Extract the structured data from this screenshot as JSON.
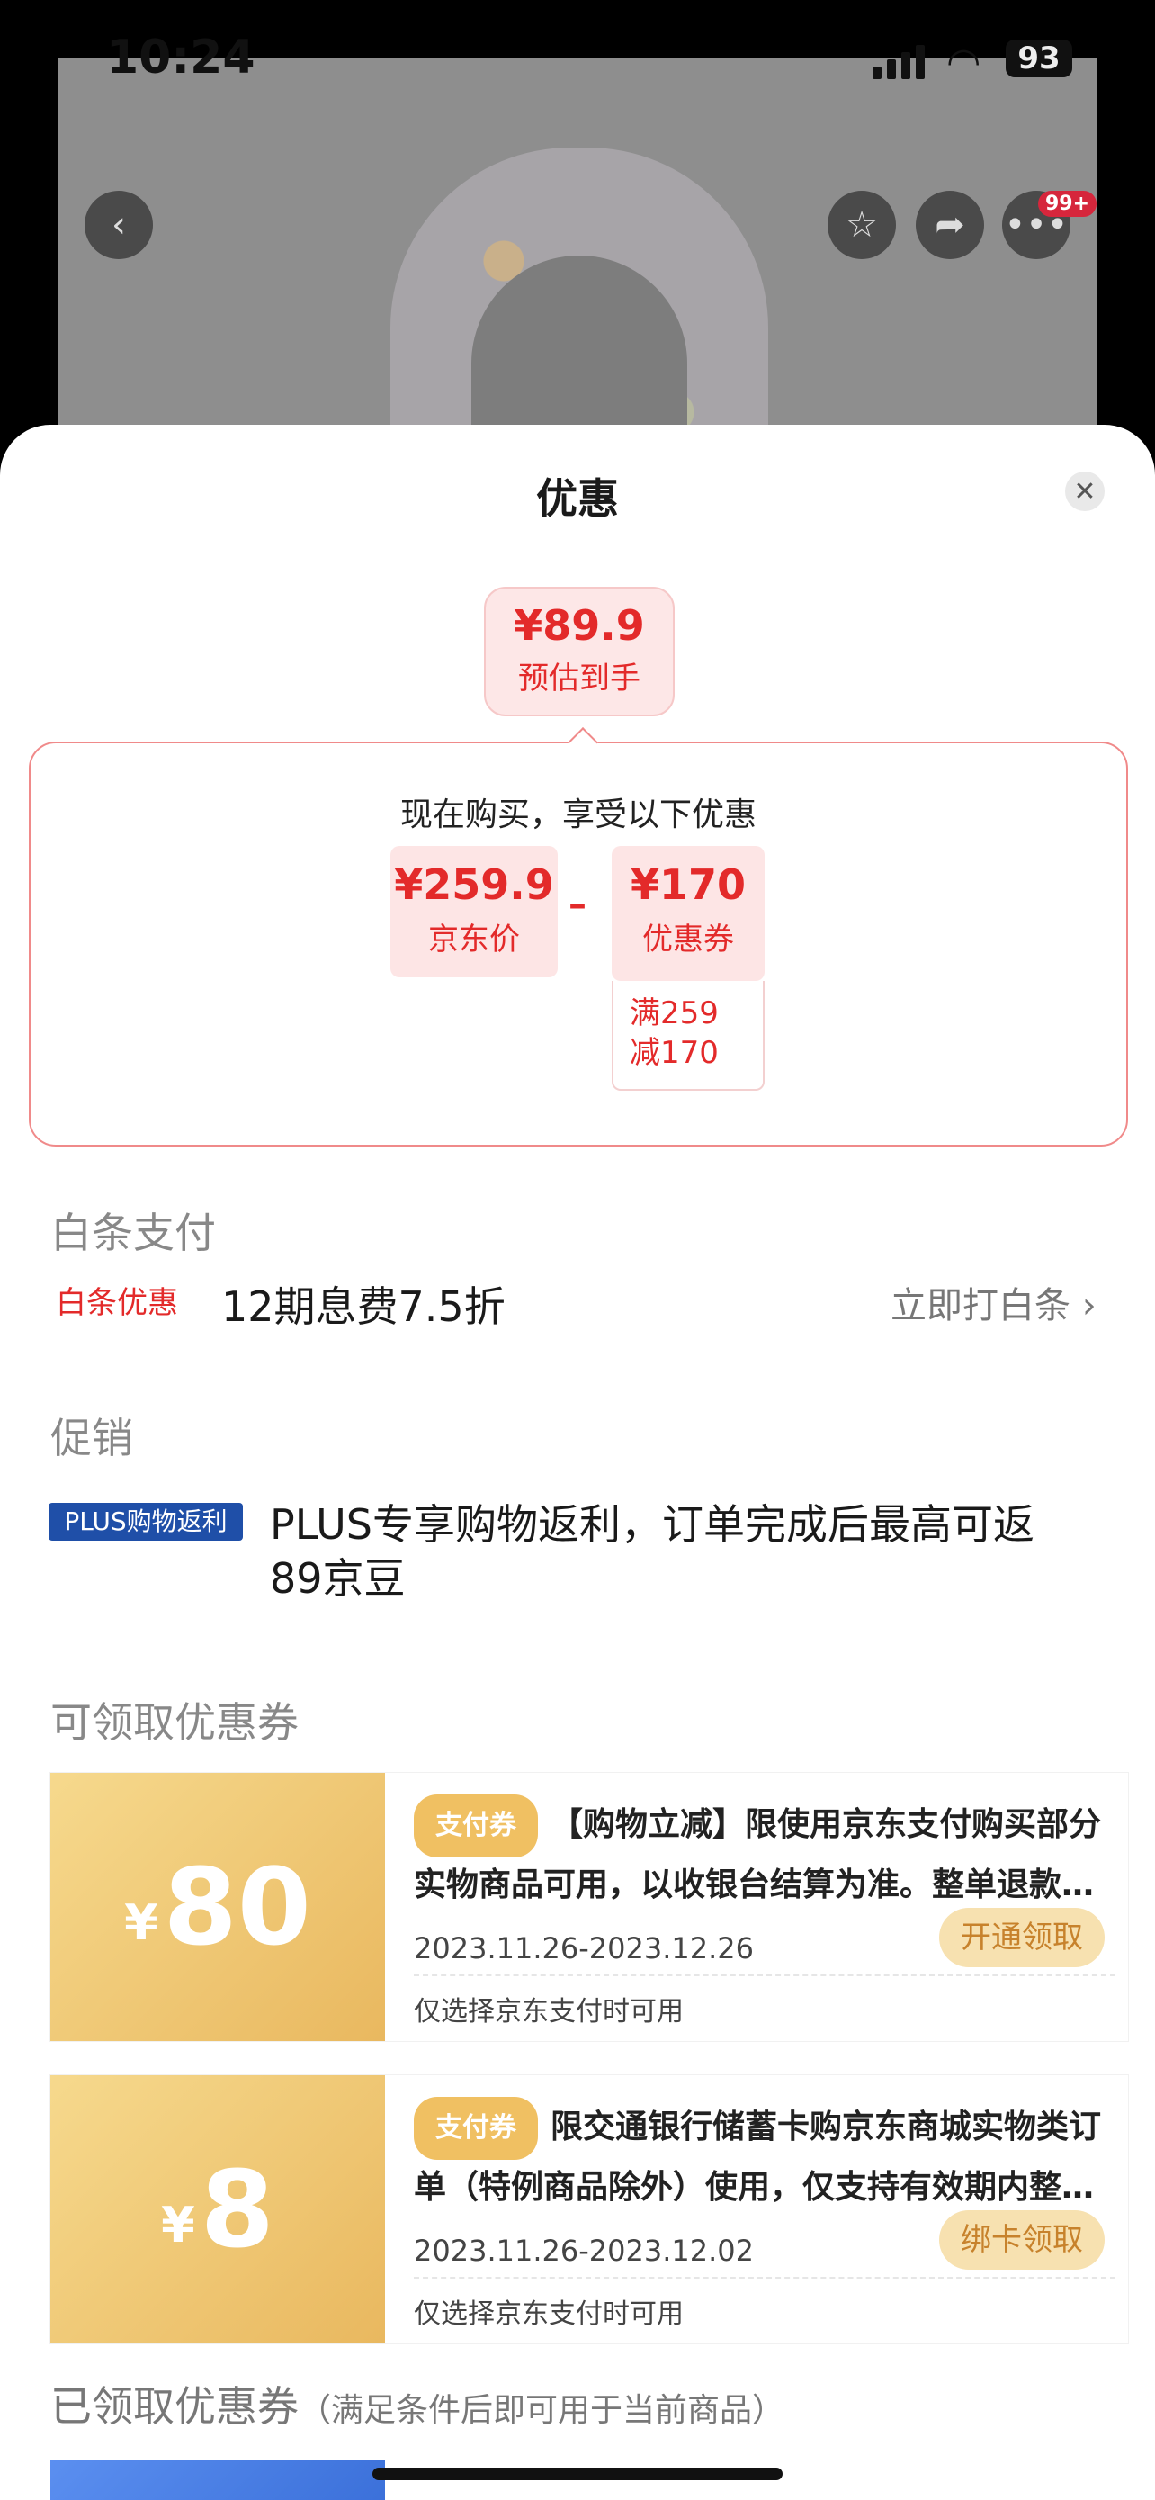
{
  "status": {
    "time": "10:24",
    "battery": "93"
  },
  "nav": {
    "badge": "99+"
  },
  "sheet": {
    "title": "优惠",
    "estimate": {
      "price": "¥89.9",
      "label": "预估到手"
    },
    "calc": {
      "heading": "现在购买，享受以下优惠",
      "jd_price": {
        "value": "¥259.9",
        "label": "京东价"
      },
      "operator": "–",
      "coupon": {
        "value": "¥170",
        "label": "优惠券",
        "cond_line1": "满259",
        "cond_line2": "减170"
      }
    },
    "baitiao": {
      "title": "白条支付",
      "tag": "白条优惠",
      "text": "12期息费7.5折",
      "link": "立即打白条 ›"
    },
    "promo": {
      "title": "促销",
      "tag": "PLUS购物返利",
      "text": "PLUS专享购物返利，订单完成后最高可返89京豆"
    },
    "available": {
      "title": "可领取优惠券",
      "coupons": [
        {
          "yen": "¥",
          "amount": "80",
          "tag": "支付券",
          "desc": "【购物立减】限使用京东支付购买部分实物商品可用，以收银台结算为准。整单退款…",
          "date": "2023.11.26-2023.12.26",
          "button": "开通领取",
          "note": "仅选择京东支付时可用"
        },
        {
          "yen": "¥",
          "amount": "8",
          "tag": "支付券",
          "desc": "限交通银行储蓄卡购京东商城实物类订单（特例商品除外）使用，仅支持有效期内整…",
          "date": "2023.11.26-2023.12.02",
          "button": "绑卡领取",
          "note": "仅选择京东支付时可用"
        }
      ]
    },
    "claimed": {
      "title": "已领取优惠券",
      "subtitle": "（满足条件后即可用于当前商品）"
    }
  }
}
